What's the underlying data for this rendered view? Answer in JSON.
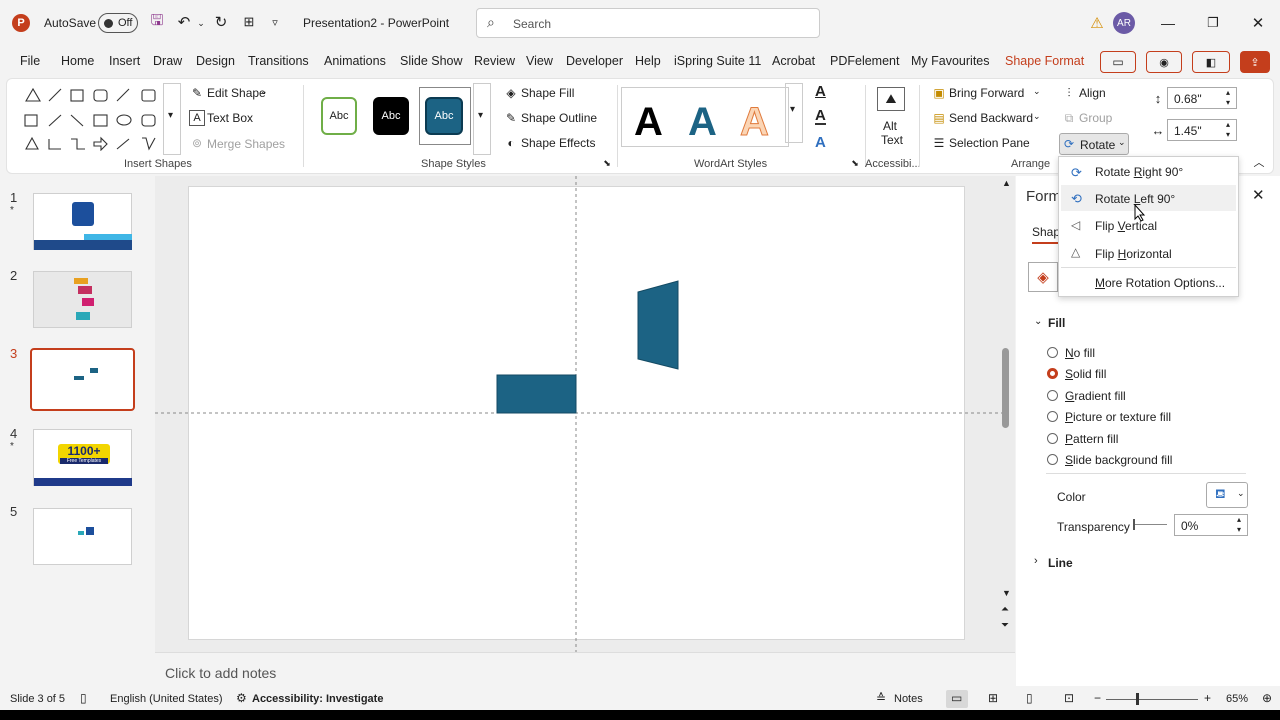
{
  "app": {
    "autosave_label": "AutoSave",
    "autosave_state": "Off",
    "doc_title": "Presentation2 - PowerPoint",
    "search_placeholder": "Search",
    "user_initials": "AR"
  },
  "menu": [
    "File",
    "Home",
    "Insert",
    "Draw",
    "Design",
    "Transitions",
    "Animations",
    "Slide Show",
    "Review",
    "View",
    "Developer",
    "Help",
    "iSpring Suite 11",
    "Acrobat",
    "PDFelement",
    "My Favourites",
    "Shape Format"
  ],
  "ribbon": {
    "insert_shapes": {
      "edit_shape": "Edit Shape",
      "text_box": "Text Box",
      "merge_shapes": "Merge Shapes",
      "label": "Insert Shapes"
    },
    "shape_styles": {
      "style_text": "Abc",
      "fill": "Shape Fill",
      "outline": "Shape Outline",
      "effects": "Shape Effects",
      "label": "Shape Styles"
    },
    "wordart": {
      "letter": "A",
      "label": "WordArt Styles"
    },
    "accessibility": {
      "alt_text_line1": "Alt",
      "alt_text_line2": "Text",
      "label": "Accessibi..."
    },
    "arrange": {
      "bring_forward": "Bring Forward",
      "send_backward": "Send Backward",
      "selection_pane": "Selection Pane",
      "align": "Align",
      "group": "Group",
      "rotate": "Rotate",
      "label": "Arrange"
    },
    "size": {
      "height": "0.68\"",
      "width": "1.45\""
    }
  },
  "rotate_menu": [
    {
      "pre": "Rotate ",
      "u": "R",
      "post": "ight 90°"
    },
    {
      "pre": "Rotate ",
      "u": "L",
      "post": "eft 90°"
    },
    {
      "pre": "Flip ",
      "u": "V",
      "post": "ertical"
    },
    {
      "pre": "Flip ",
      "u": "H",
      "post": "orizontal"
    },
    {
      "pre": "",
      "u": "M",
      "post": "ore Rotation Options..."
    }
  ],
  "slides": [
    {
      "num": "1",
      "star": "*"
    },
    {
      "num": "2",
      "star": ""
    },
    {
      "num": "3",
      "star": ""
    },
    {
      "num": "4",
      "star": "*",
      "thumb_text": "1100+",
      "thumb_sub": "Free Templates"
    },
    {
      "num": "5",
      "star": ""
    }
  ],
  "notes_placeholder": "Click to add notes",
  "format_pane": {
    "title": "Form",
    "tab": "Shap",
    "fill_header": "Fill",
    "fill_options": [
      {
        "u": "N",
        "rest": "o fill",
        "selected": false
      },
      {
        "u": "S",
        "rest": "olid fill",
        "selected": true
      },
      {
        "u": "G",
        "rest": "radient fill",
        "selected": false
      },
      {
        "u": "P",
        "rest": "icture or texture fill",
        "selected": false
      },
      {
        "u": "P",
        "rest": "attern fill",
        "selected": false
      },
      {
        "u": "S",
        "rest": "lide background fill",
        "selected": false
      }
    ],
    "color_label": "Color",
    "transparency_label": "Transparency",
    "transparency_value": "0%",
    "line_header": "Line"
  },
  "status": {
    "slide_info": "Slide 3 of 5",
    "language": "English (United States)",
    "accessibility": "Accessibility: Investigate",
    "notes": "Notes",
    "zoom": "65%"
  },
  "colors": {
    "accent": "#c43e1c",
    "shape": "#1c6384",
    "tab_active": "#c43e1c"
  }
}
